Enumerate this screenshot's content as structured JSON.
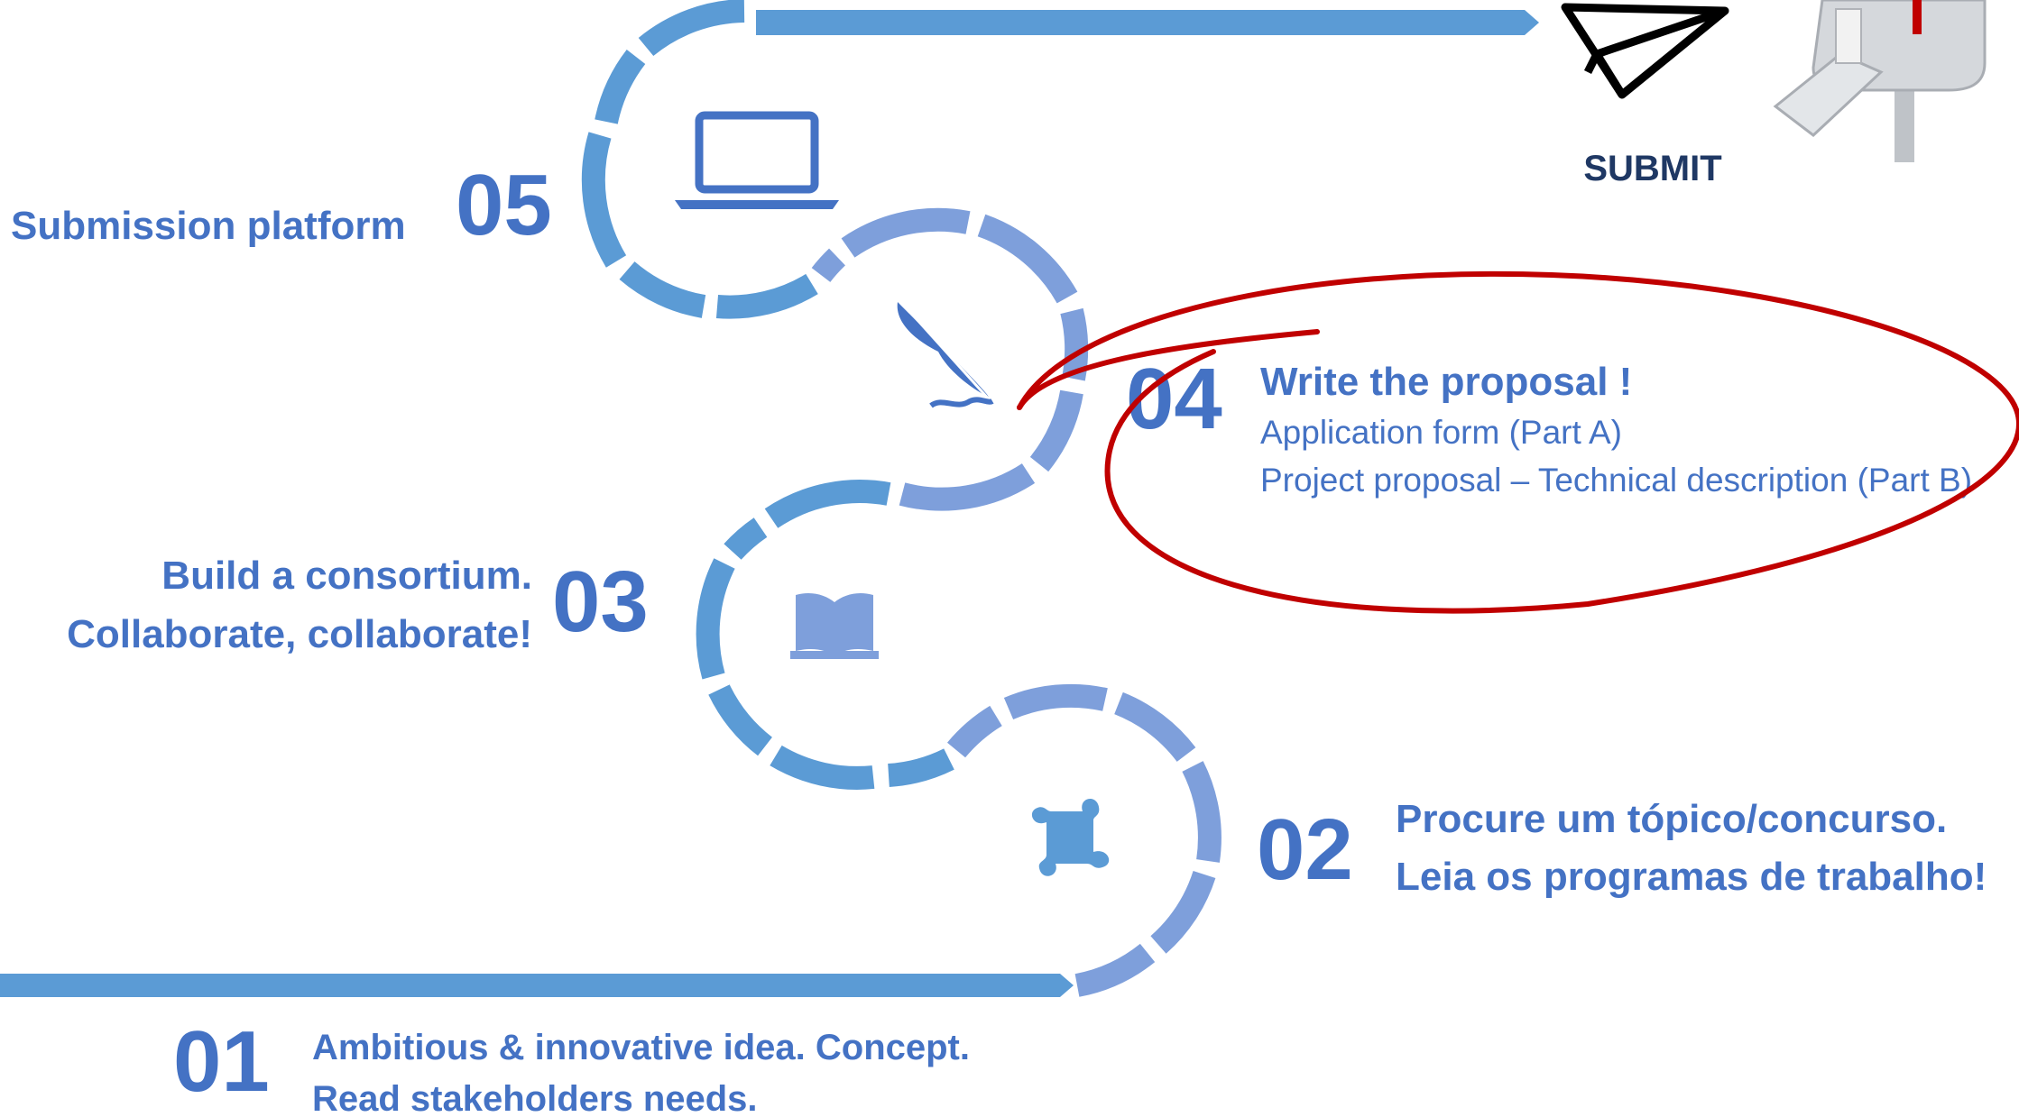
{
  "colors": {
    "primary_blue": "#4472C4",
    "path_blue": "#5B9BD5",
    "path_lavender": "#7E9FDB",
    "submit_navy": "#1F3864",
    "annotation_red": "#C00000"
  },
  "steps": [
    {
      "number": "01",
      "lines": [
        "Ambitious & innovative idea. Concept.",
        "Read stakeholders needs."
      ],
      "icon": "lightbulb-icon"
    },
    {
      "number": "02",
      "lines": [
        "Procure um tópico/concurso.",
        "Leia os programas de trabalho!"
      ],
      "icon": "puzzle-icon"
    },
    {
      "number": "03",
      "lines": [
        "Build a consortium.",
        "Collaborate, collaborate!"
      ],
      "icon": "book-icon"
    },
    {
      "number": "04",
      "title": "Write the proposal !",
      "lines": [
        "Application form (Part A)",
        "Project proposal – Technical description (Part B)"
      ],
      "icon": "quill-pen-icon"
    },
    {
      "number": "05",
      "lines": [
        "Submission platform"
      ],
      "icon": "laptop-icon"
    }
  ],
  "submit": {
    "label": "SUBMIT",
    "icons": [
      "paper-plane-icon",
      "mailbox-icon"
    ]
  },
  "annotation": {
    "shape": "hand-drawn-ellipse",
    "target_step": "04"
  }
}
